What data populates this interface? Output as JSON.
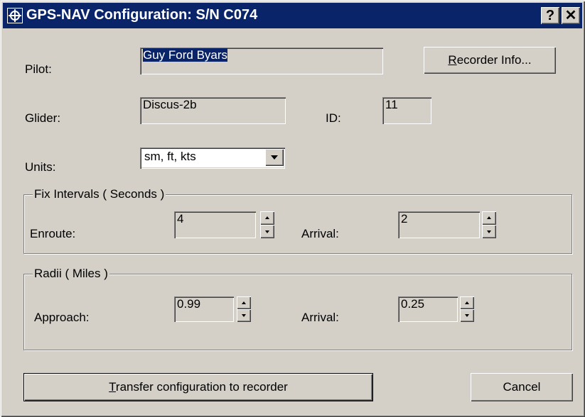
{
  "window": {
    "title": "GPS-NAV Configuration: S/N  C074",
    "help_label": "?",
    "close_label": "✕"
  },
  "pilot": {
    "label": "Pilot:",
    "value": "Guy Ford Byars"
  },
  "recorder_info": {
    "accel": "R",
    "rest": "ecorder Info..."
  },
  "glider": {
    "label": "Glider:",
    "value": "Discus-2b"
  },
  "id": {
    "label": "ID:",
    "value": "11"
  },
  "units": {
    "label": "Units:",
    "selected": "sm, ft, kts"
  },
  "fix_intervals": {
    "title": "Fix Intervals ( Seconds )",
    "enroute_label": "Enroute:",
    "enroute_value": "4",
    "arrival_label": "Arrival:",
    "arrival_value": "2"
  },
  "radii": {
    "title": "Radii ( Miles )",
    "approach_label": "Approach:",
    "approach_value": "0.99",
    "arrival_label": "Arrival:",
    "arrival_value": "0.25"
  },
  "transfer": {
    "accel": "T",
    "rest": "ransfer configuration to recorder"
  },
  "cancel_label": "Cancel",
  "colors": {
    "titlebar": "#0a246a",
    "face": "#d4d0c8"
  }
}
